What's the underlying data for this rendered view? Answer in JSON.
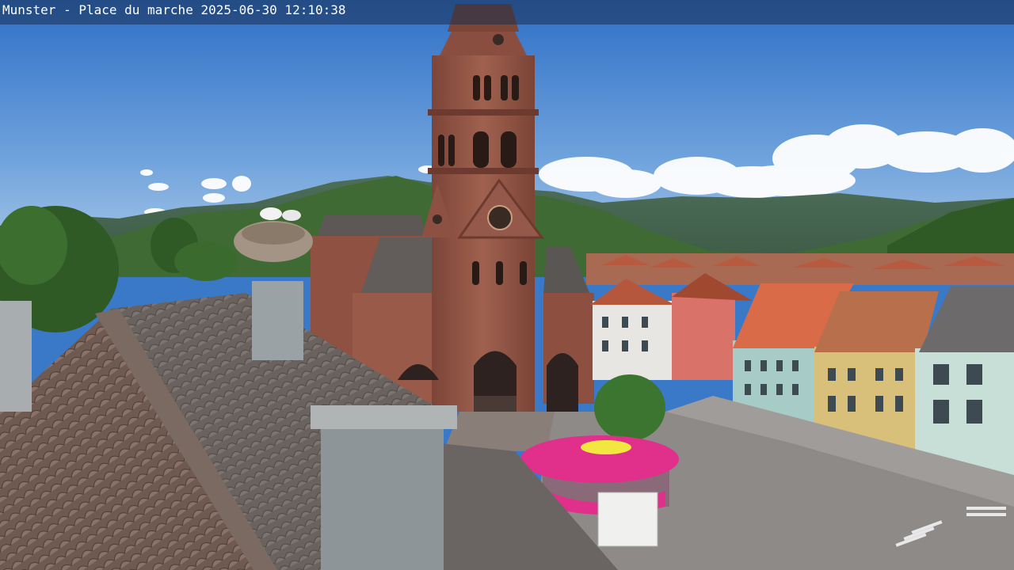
{
  "overlay": {
    "location": "Munster - Place du marche",
    "timestamp": "2025-06-30 12:10:38"
  },
  "colors": {
    "sky_top": "#2f6fc6",
    "sky_bottom": "#8fb6e0",
    "sandstone": "#9a5a4a",
    "roof_slate": "#5e5a58",
    "kiosk_roof": "#e0308c"
  }
}
